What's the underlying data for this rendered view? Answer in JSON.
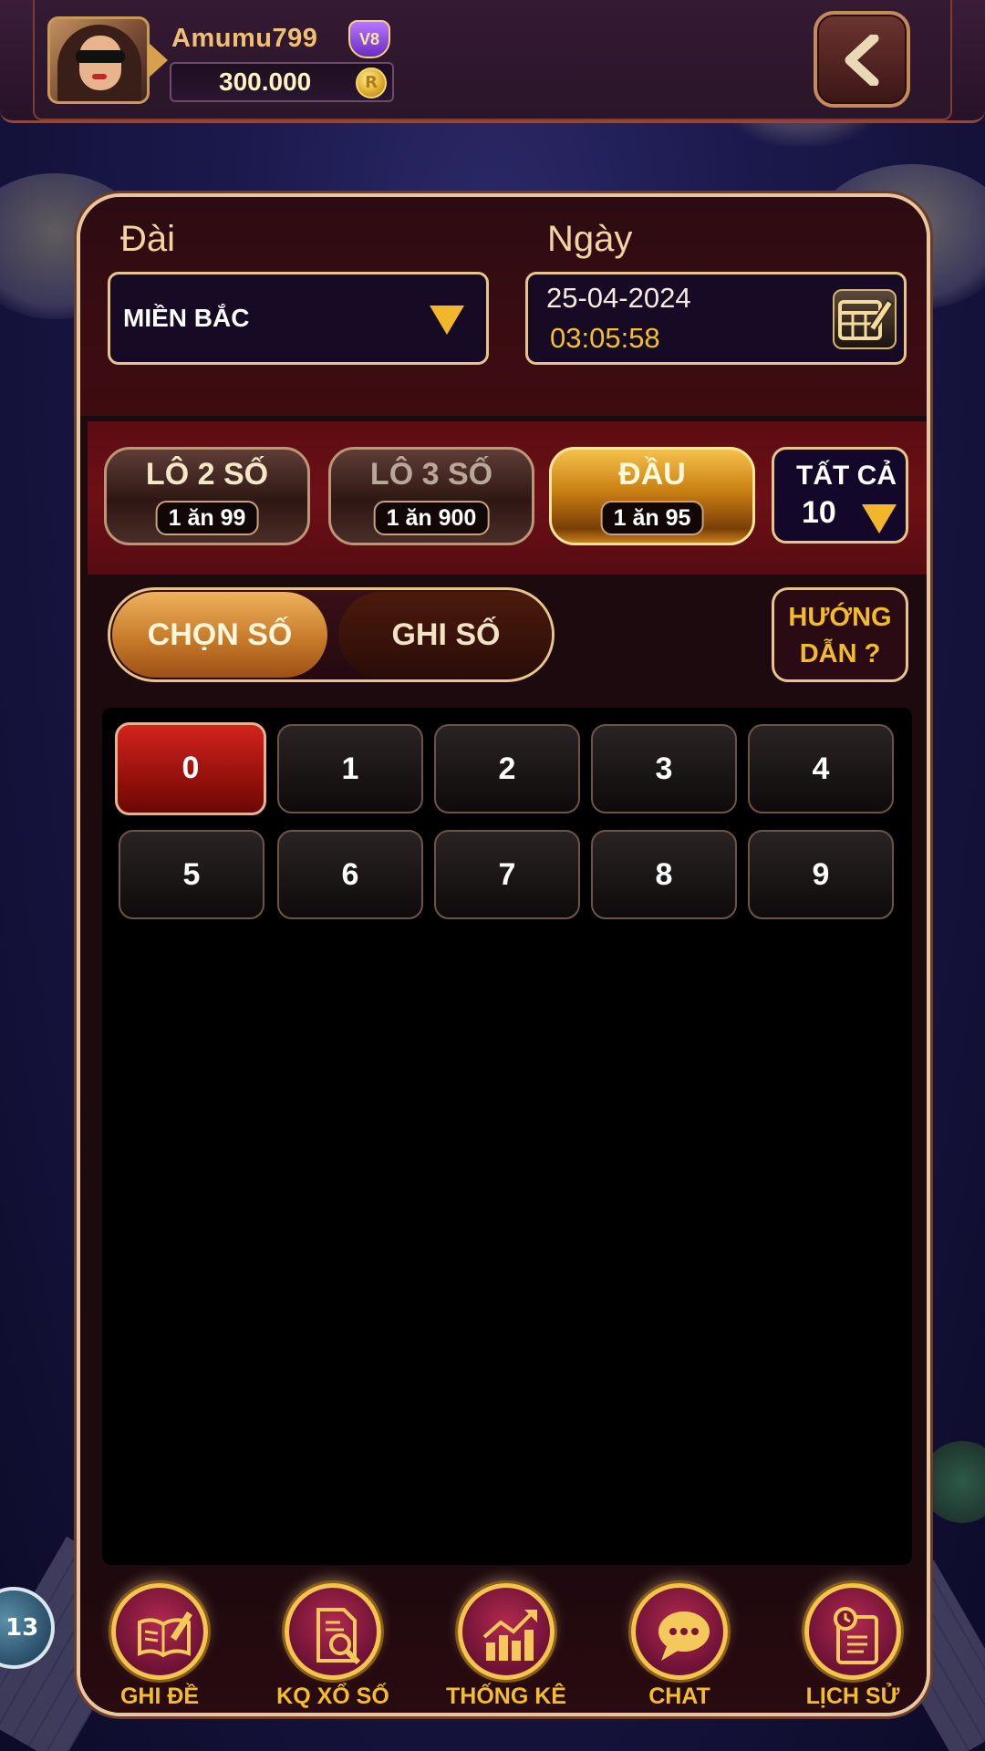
{
  "header": {
    "username": "Amumu799",
    "vip_level": "V8",
    "balance": "300.000",
    "coin_symbol": "R"
  },
  "form": {
    "station_label": "Đài",
    "station_value": "MIỀN BẮC",
    "date_label": "Ngày",
    "date_value": "25-04-2024",
    "time_value": "03:05:58"
  },
  "bet_types": [
    {
      "title": "LÔ 2 SỐ",
      "odds": "1 ăn 99",
      "state": "normal"
    },
    {
      "title": "LÔ 3 SỐ",
      "odds": "1 ăn 900",
      "state": "dim"
    },
    {
      "title": "ĐẦU",
      "odds": "1 ăn 95",
      "state": "active"
    }
  ],
  "filter": {
    "label": "TẤT CẢ",
    "value": "10"
  },
  "mode": {
    "pick_label": "CHỌN SỐ",
    "write_label": "GHI SỐ",
    "active": "pick"
  },
  "guide": {
    "line1": "HƯỚNG",
    "line2": "DẪN  ?"
  },
  "numbers": [
    "0",
    "1",
    "2",
    "3",
    "4",
    "5",
    "6",
    "7",
    "8",
    "9"
  ],
  "selected_number": "0",
  "nav": [
    {
      "label": "GHI ĐỀ",
      "icon": "book-pen-icon"
    },
    {
      "label": "KQ XỔ SỐ",
      "icon": "document-search-icon"
    },
    {
      "label": "THỐNG KÊ",
      "icon": "chart-trend-icon"
    },
    {
      "label": "CHAT",
      "icon": "chat-bubble-icon"
    },
    {
      "label": "LỊCH SỬ",
      "icon": "history-clipboard-icon"
    }
  ],
  "colors": {
    "accent_gold": "#f2b62b",
    "panel_border": "#e8c6a0",
    "selected_red": "#d3231c",
    "nav_label": "#f4bd2a"
  }
}
